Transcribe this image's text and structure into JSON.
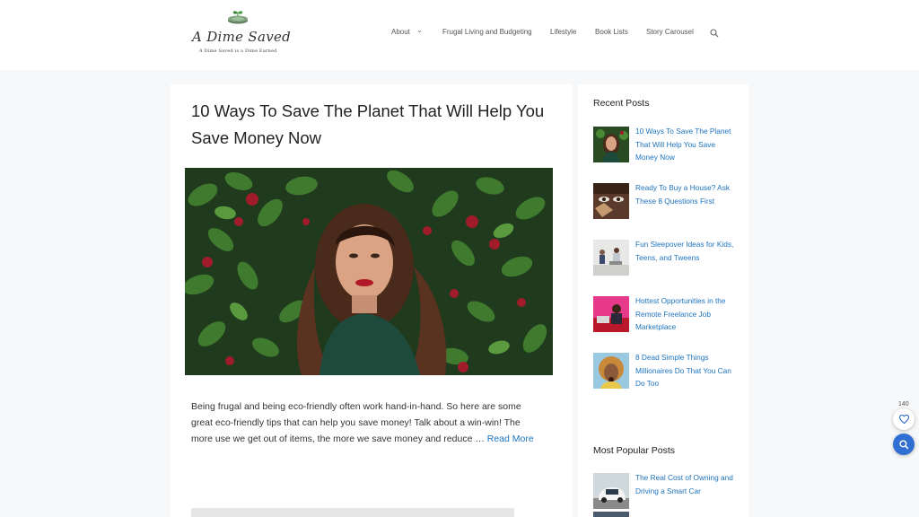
{
  "site": {
    "logo_text": "A Dime Saved",
    "logo_tagline": "A Dime Saved is a Dime Earned"
  },
  "nav": {
    "items": [
      "About",
      "Frugal Living and Budgeting",
      "Lifestyle",
      "Book Lists",
      "Story Carousel"
    ]
  },
  "post": {
    "title": "10 Ways To Save The Planet That Will Help You Save Money Now",
    "excerpt": "Being frugal and being eco-friendly often work hand-in-hand. So here are some great eco-friendly tips that can help you save money! Talk about a win-win! The more use we get out of items, the more we save money and reduce … ",
    "read_more": "Read More"
  },
  "sidebar": {
    "recent_title": "Recent Posts",
    "recent": [
      "10 Ways To Save The Planet That Will Help You Save Money Now",
      "Ready To Buy a House? Ask These 8 Questions First",
      "Fun Sleepover Ideas for Kids, Teens, and Tweens",
      "Hottest Opportunities in the Remote Freelance Job Marketplace",
      "8 Dead Simple Things Millionaires Do That You Can Do Too"
    ],
    "popular_title": "Most Popular Posts",
    "popular": [
      "The Real Cost of Owning and Driving a Smart Car"
    ]
  },
  "floating": {
    "like_count": "140"
  },
  "colors": {
    "link": "#1e73be",
    "accent_button": "#2f6fd1"
  }
}
